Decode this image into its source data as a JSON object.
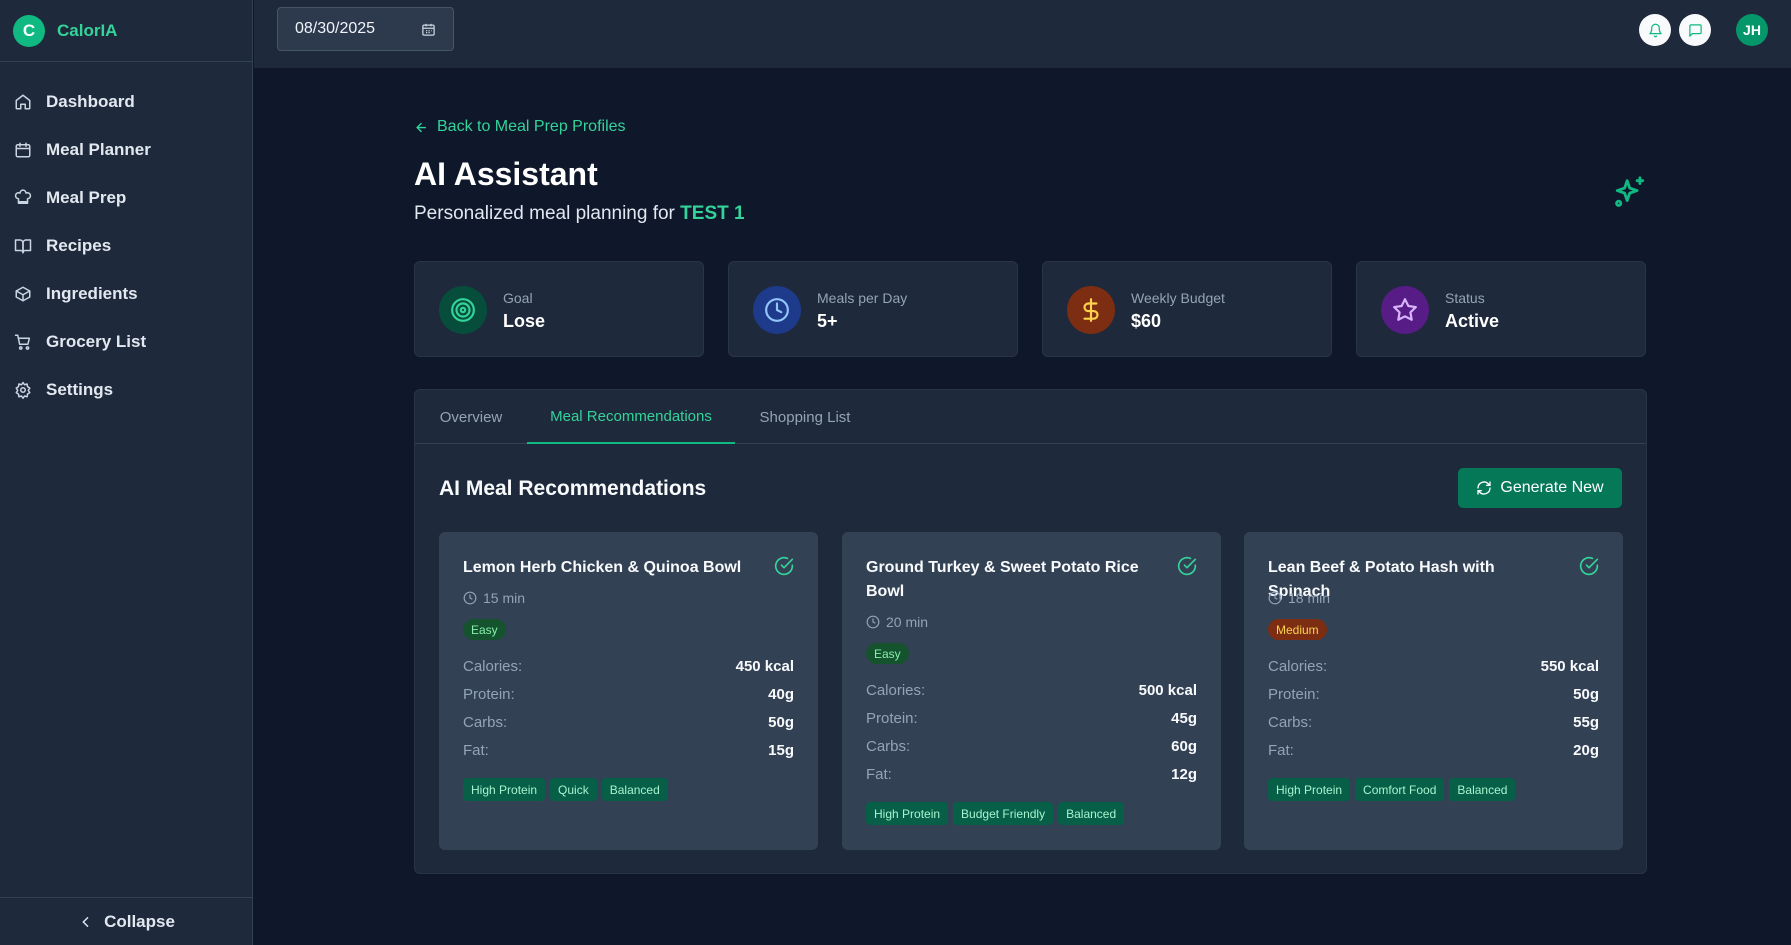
{
  "brand": {
    "logo_letter": "C",
    "name": "CalorIA"
  },
  "sidebar": {
    "items": [
      {
        "label": "Dashboard",
        "icon": "home-icon"
      },
      {
        "label": "Meal Planner",
        "icon": "calendar-icon"
      },
      {
        "label": "Meal Prep",
        "icon": "chef-hat-icon"
      },
      {
        "label": "Recipes",
        "icon": "book-open-icon"
      },
      {
        "label": "Ingredients",
        "icon": "package-icon"
      },
      {
        "label": "Grocery List",
        "icon": "cart-icon"
      },
      {
        "label": "Settings",
        "icon": "gear-icon"
      }
    ],
    "collapse_label": "Collapse"
  },
  "topbar": {
    "date_value": "08/30/2025",
    "avatar_initials": "JH"
  },
  "header": {
    "back_label": "Back to Meal Prep Profiles",
    "title": "AI Assistant",
    "subtitle_prefix": "Personalized meal planning for",
    "profile_name": "TEST 1"
  },
  "stats": [
    {
      "label": "Goal",
      "value": "Lose",
      "icon": "target-icon",
      "color": "#10b981"
    },
    {
      "label": "Meals per Day",
      "value": "5+",
      "icon": "clock-icon",
      "color": "#3b82f6"
    },
    {
      "label": "Weekly Budget",
      "value": "$60",
      "icon": "dollar-icon",
      "color": "#f59e0b"
    },
    {
      "label": "Status",
      "value": "Active",
      "icon": "star-icon",
      "color": "#a855f7"
    }
  ],
  "tabs": [
    "Overview",
    "Meal Recommendations",
    "Shopping List"
  ],
  "active_tab": "Meal Recommendations",
  "recommendations": {
    "title": "AI Meal Recommendations",
    "generate_label": "Generate New",
    "nutrition_labels": {
      "calories": "Calories:",
      "protein": "Protein:",
      "carbs": "Carbs:",
      "fat": "Fat:"
    },
    "meals": [
      {
        "name": "Lemon Herb Chicken & Quinoa Bowl",
        "time": "15 min",
        "difficulty": "Easy",
        "calories": "450 kcal",
        "protein": "40g",
        "carbs": "50g",
        "fat": "15g",
        "tags": [
          "High Protein",
          "Quick",
          "Balanced"
        ]
      },
      {
        "name": "Ground Turkey & Sweet Potato Rice Bowl",
        "time": "20 min",
        "difficulty": "Easy",
        "calories": "500 kcal",
        "protein": "45g",
        "carbs": "60g",
        "fat": "12g",
        "tags": [
          "High Protein",
          "Budget Friendly",
          "Balanced"
        ]
      },
      {
        "name": "Lean Beef & Potato Hash with Spinach",
        "time": "18 min",
        "difficulty": "Medium",
        "calories": "550 kcal",
        "protein": "50g",
        "carbs": "55g",
        "fat": "20g",
        "tags": [
          "High Protein",
          "Comfort Food",
          "Balanced"
        ]
      }
    ]
  },
  "colors": {
    "accent": "#10b981",
    "background": "#0f172a",
    "surface": "#1e293b",
    "card": "#334155"
  }
}
